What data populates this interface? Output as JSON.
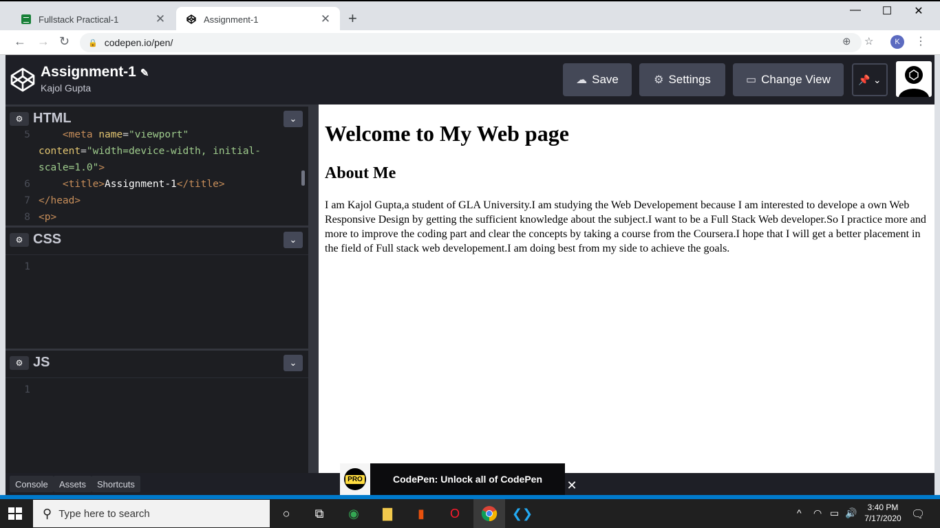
{
  "browser": {
    "tabs": [
      {
        "title": "Fullstack Practical-1",
        "icon": "google-sheets-icon",
        "active": false
      },
      {
        "title": "Assignment-1",
        "icon": "codepen-icon",
        "active": true
      }
    ],
    "url": "codepen.io/pen/",
    "profile_initial": "K"
  },
  "codepen": {
    "pen_title": "Assignment-1",
    "author": "Kajol Gupta",
    "buttons": {
      "save": "Save",
      "settings": "Settings",
      "change_view": "Change View"
    },
    "editors": {
      "html": {
        "name": "HTML",
        "lines": [
          {
            "n": "5",
            "html": "    <span class='tag'>&lt;meta</span> <span class='attr'>name</span>=<span class='str'>\"viewport\"</span>"
          },
          {
            "n": "",
            "html": "<span class='attr'>content</span>=<span class='str'>\"width=device-width, initial-</span>"
          },
          {
            "n": "",
            "html": "<span class='str'>scale=1.0\"</span><span class='tag'>&gt;</span>"
          },
          {
            "n": "6",
            "html": "    <span class='tag'>&lt;title&gt;</span><span class='txt'>Assignment-1</span><span class='tag'>&lt;/title&gt;</span>"
          },
          {
            "n": "7",
            "html": "<span class='tag'>&lt;/head&gt;</span>"
          },
          {
            "n": "8",
            "html": "<span class='tag'>&lt;p&gt;</span>"
          }
        ]
      },
      "css": {
        "name": "CSS",
        "first_line": "1"
      },
      "js": {
        "name": "JS",
        "first_line": "1"
      }
    },
    "preview": {
      "heading1": "Welcome to My Web page",
      "heading2": "About Me",
      "paragraph": "I am Kajol Gupta,a student of GLA University.I am studying the Web Developement because I am interested to develope a own Web Responsive Design by getting the sufficient knowledge about the subject.I want to be a Full Stack Web developer.So I practice more and more to improve the coding part and clear the concepts by taking a course from the Coursera.I hope that I will get a better placement in the field of Full stack web developement.I am doing best from my side to achieve the goals."
    },
    "bottom": {
      "console": "Console",
      "assets": "Assets",
      "shortcuts": "Shortcuts"
    },
    "pro_banner": {
      "badge": "PRO",
      "text": "CodePen: Unlock all of CodePen"
    }
  },
  "taskbar": {
    "search_placeholder": "Type here to search",
    "time": "3:40 PM",
    "date": "7/17/2020"
  },
  "colors": {
    "codepen_dark": "#1e1f26",
    "editor_bg": "#1d1e22",
    "button_bg": "#444857",
    "vscode_blue": "#007acc"
  }
}
